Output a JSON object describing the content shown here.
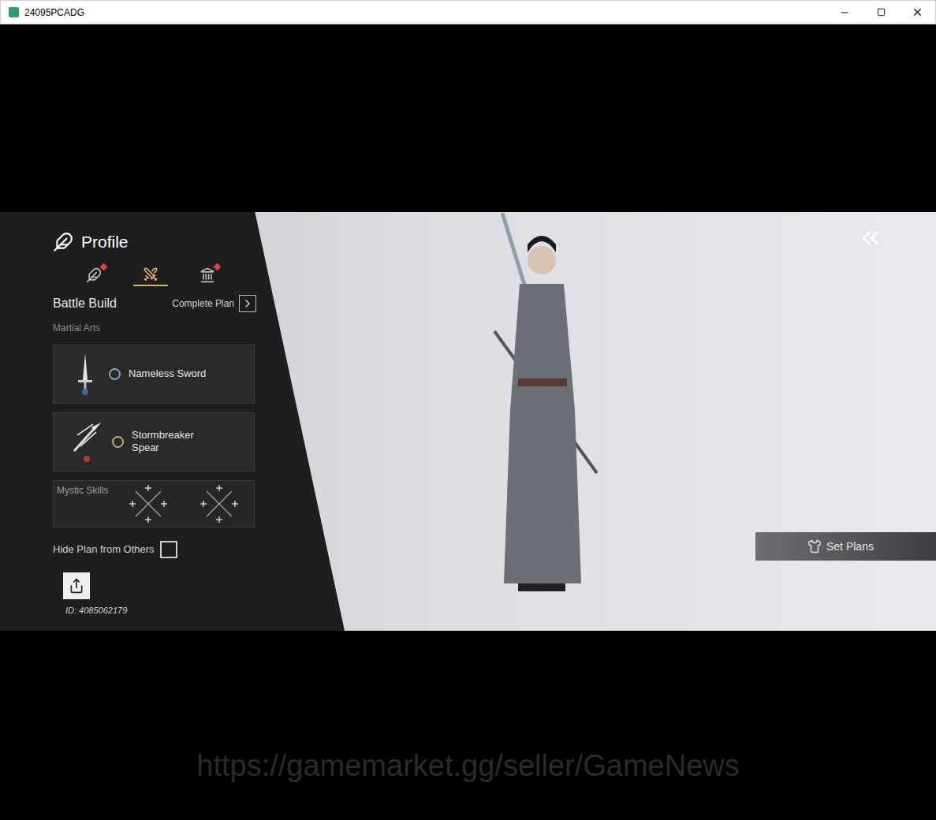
{
  "window": {
    "title": "24095PCADG"
  },
  "profile": {
    "title": "Profile",
    "tabs": [
      {
        "kind": "profile",
        "selected": false,
        "alert": true
      },
      {
        "kind": "battle",
        "selected": true,
        "alert": false
      },
      {
        "kind": "guild",
        "selected": false,
        "alert": true
      }
    ]
  },
  "battle_build": {
    "title": "Battle Build",
    "complete_plan": "Complete Plan",
    "section": "Martial Arts",
    "martial_arts": [
      {
        "name": "Nameless Sword",
        "kind": "sword",
        "color": "#7fa7c9"
      },
      {
        "name": "Stormbreaker Spear",
        "kind": "spear",
        "color": "#c9a86a"
      }
    ],
    "mystic_skills": {
      "label": "Mystic Skills"
    },
    "hide_plan": {
      "label": "Hide Plan from Others",
      "checked": false
    },
    "id": "ID: 4085062179"
  },
  "set_plans": "Set Plans",
  "watermark": "https://gamemarket.gg/seller/GameNews"
}
